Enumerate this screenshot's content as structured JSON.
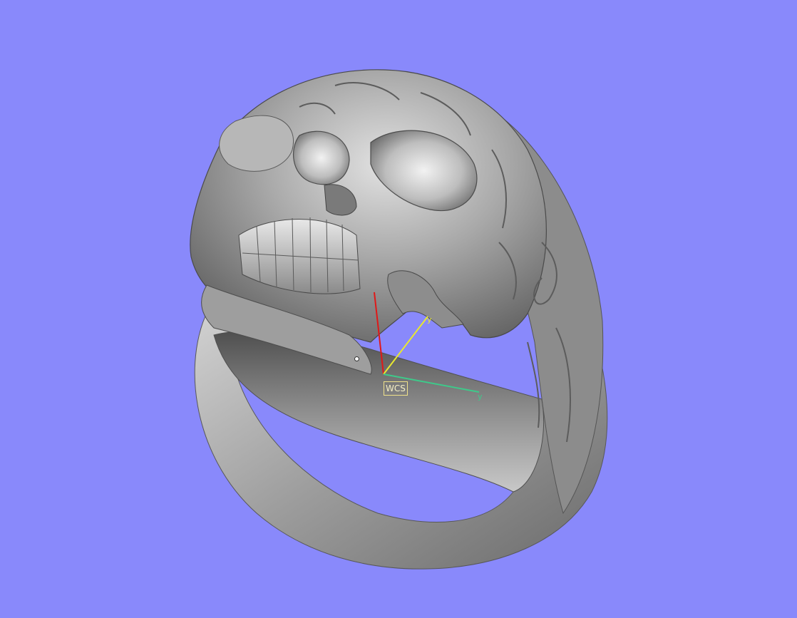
{
  "viewport": {
    "background_color": "#8989fb",
    "model_name": "skull-ring",
    "wcs_label": "WCS",
    "axes": {
      "x": {
        "label": "",
        "color": "#e01818"
      },
      "y": {
        "label": "y",
        "color": "#e8e830"
      },
      "z": {
        "label": "y",
        "color": "#3ec98a"
      }
    }
  }
}
